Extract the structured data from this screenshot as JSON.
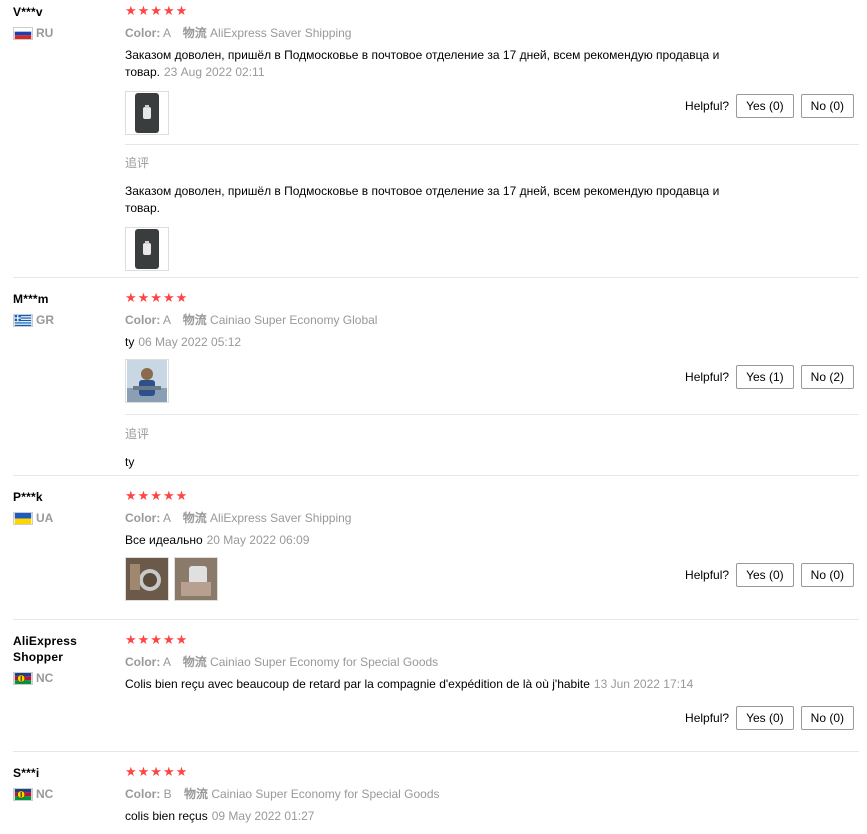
{
  "labels": {
    "color": "Color:",
    "shipping": "物流",
    "helpful": "Helpful?",
    "append": "追评"
  },
  "stars": "★★★★★",
  "reviews": [
    {
      "user": "V***v",
      "country": "RU",
      "color": "A",
      "shipping": "AliExpress Saver Shipping",
      "text": "Заказом доволен, пришёл в Подмосковье в почтовое отделение за 17 дней, всем рекомендую продавца и товар.",
      "date": "23 Aug 2022 02:11",
      "yes": "Yes (0)",
      "no": "No (0)",
      "append_text": "Заказом доволен, пришёл в Подмосковье в почтовое отделение за 17 дней, всем рекомендую продавца и товар."
    },
    {
      "user": "M***m",
      "country": "GR",
      "color": "A",
      "shipping": "Cainiao Super Economy Global",
      "text": "ty",
      "date": "06 May 2022 05:12",
      "yes": "Yes (1)",
      "no": "No (2)",
      "append_text": "ty"
    },
    {
      "user": "P***k",
      "country": "UA",
      "color": "A",
      "shipping": "AliExpress Saver Shipping",
      "text": "Все идеально",
      "date": "20 May 2022 06:09",
      "yes": "Yes (0)",
      "no": "No (0)"
    },
    {
      "user": "AliExpress Shopper",
      "country": "NC",
      "color": "A",
      "shipping": "Cainiao Super Economy for Special Goods",
      "text": "Colis bien reçu avec beaucoup de retard par la compagnie d'expédition de là où j'habite",
      "date": "13 Jun 2022 17:14",
      "yes": "Yes (0)",
      "no": "No (0)"
    },
    {
      "user": "S***i",
      "country": "NC",
      "color": "B",
      "shipping": "Cainiao Super Economy for Special Goods",
      "text": "colis bien reçus",
      "date": "09 May 2022 01:27"
    }
  ]
}
